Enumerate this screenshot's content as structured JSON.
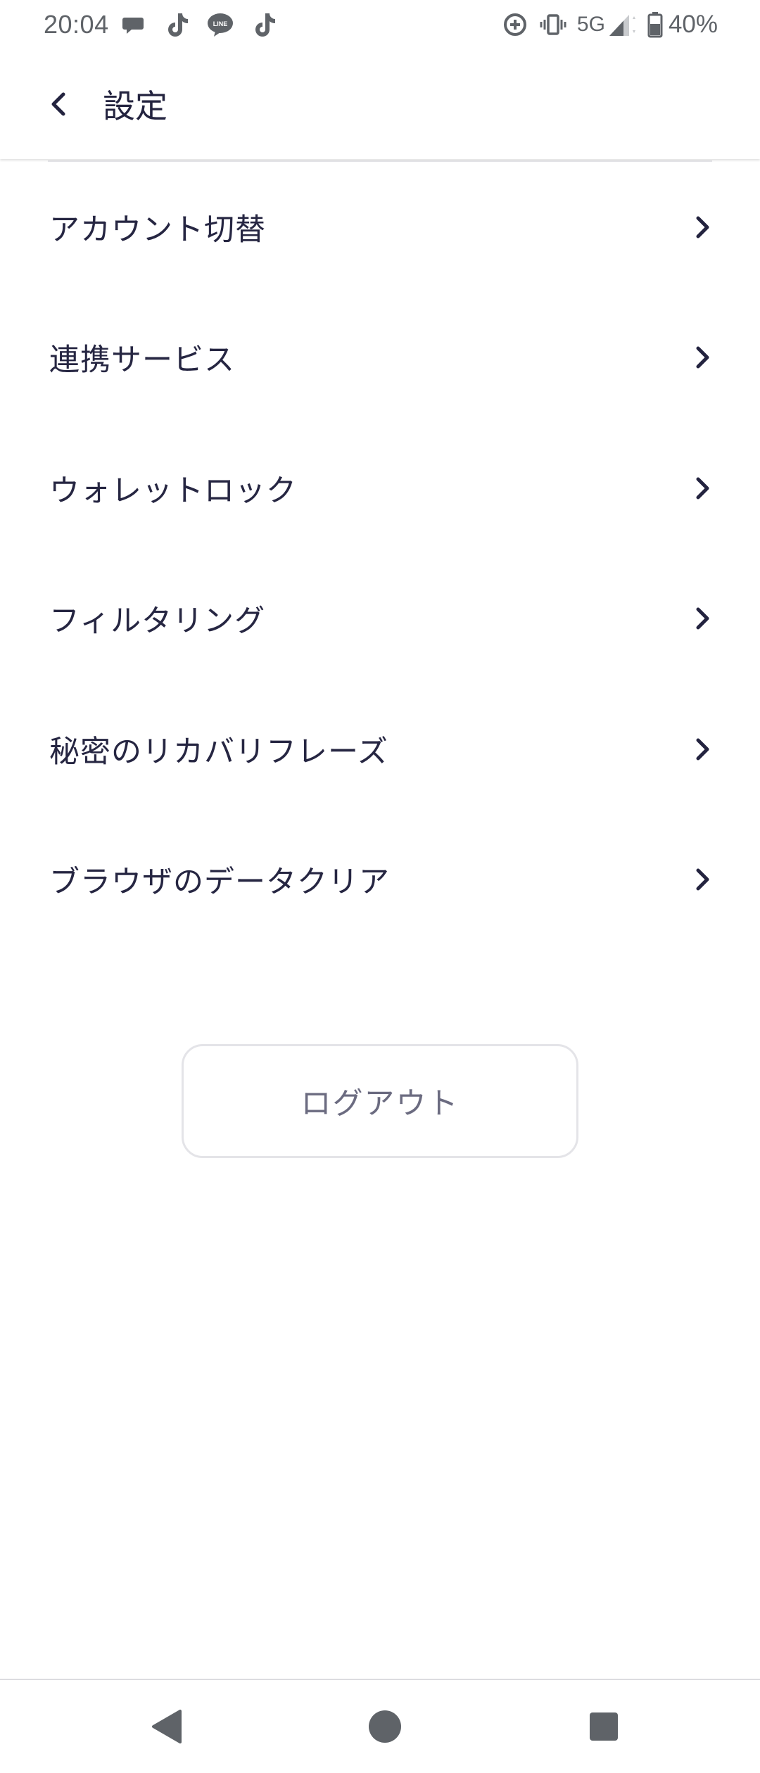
{
  "status_bar": {
    "time": "20:04",
    "notification_icons": [
      "chat-bubble-icon",
      "tiktok-icon",
      "line-icon",
      "tiktok-icon"
    ],
    "network": "5G",
    "battery_percent": "40%",
    "battery_level": 0.4
  },
  "app_bar": {
    "title": "設定",
    "back_icon": "chevron-left-icon"
  },
  "settings": {
    "items": [
      {
        "label": "アカウント切替"
      },
      {
        "label": "連携サービス"
      },
      {
        "label": "ウォレットロック"
      },
      {
        "label": "フィルタリング"
      },
      {
        "label": "秘密のリカバリフレーズ"
      },
      {
        "label": "ブラウザのデータクリア"
      }
    ]
  },
  "logout": {
    "label": "ログアウト"
  },
  "colors": {
    "text_primary": "#262642",
    "text_secondary": "#6b6b80",
    "status_gray": "#5f6368",
    "divider": "#e6e6ea",
    "button_border": "#e4e4e8"
  }
}
